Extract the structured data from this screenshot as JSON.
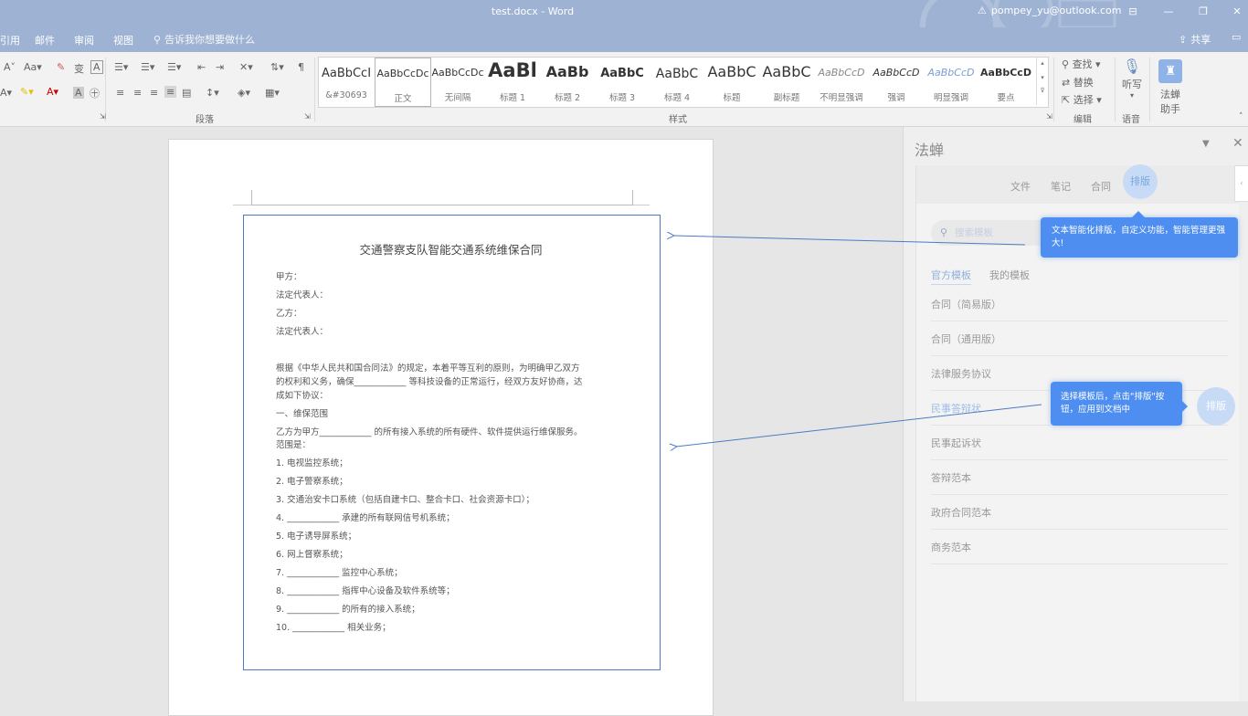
{
  "window": {
    "title": "test.docx  -  Word",
    "account": "pompey_yu@outlook.com"
  },
  "menu_tabs": [
    "引用",
    "邮件",
    "审阅",
    "视图"
  ],
  "tell_me": "告诉我你想要做什么",
  "share_label": "共享",
  "ribbon": {
    "font_group": {
      "case_label": "Aa",
      "grow_font": "A",
      "font_color_label": "A"
    },
    "paragraph_label": "段落",
    "styles_label": "样式",
    "styles": [
      {
        "sample": "AaBbCcI",
        "name": "&#30693"
      },
      {
        "sample": "AaBbCcDc",
        "name": "正文"
      },
      {
        "sample": "AaBbCcDc",
        "name": "无间隔"
      },
      {
        "sample": "AaBl",
        "name": "标题 1"
      },
      {
        "sample": "AaBb",
        "name": "标题 2"
      },
      {
        "sample": "AaBbC",
        "name": "标题 3"
      },
      {
        "sample": "AaBbC",
        "name": "标题 4"
      },
      {
        "sample": "AaBbC",
        "name": "标题"
      },
      {
        "sample": "AaBbC",
        "name": "副标题"
      },
      {
        "sample": "AaBbCcD",
        "name": "不明显强调"
      },
      {
        "sample": "AaBbCcD",
        "name": "强调"
      },
      {
        "sample": "AaBbCcD",
        "name": "明显强调"
      },
      {
        "sample": "AaBbCcD",
        "name": "要点"
      }
    ],
    "editing": {
      "find": "查找",
      "replace": "替换",
      "select": "选择",
      "label": "编辑"
    },
    "voice": {
      "dictate": "听写",
      "label": "语音"
    },
    "fachan": {
      "line1": "法蝉",
      "line2": "助手"
    }
  },
  "document": {
    "title": "交通警察支队智能交通系统维保合同",
    "lines": [
      "甲方：",
      "法定代表人：",
      "乙方：",
      "法定代表人：",
      "根据《中华人民共和国合同法》的规定，本着平等互利的原则，为明确甲乙双方",
      "的权利和义务，确保____________ 等科技设备的正常运行，经双方友好协商，达",
      "成如下协议：",
      "一、维保范围",
      "乙方为甲方____________ 的所有接入系统的所有硬件、软件提供运行维保服务。",
      "范围是：",
      "1. 电视监控系统；",
      "2. 电子警察系统；",
      "3. 交通治安卡口系统（包括自建卡口、整合卡口、社会资源卡口）；",
      "4. ____________ 承建的所有联网信号机系统；",
      "5. 电子诱导屏系统；",
      "6. 网上督察系统；",
      "7. ____________ 监控中心系统；",
      "8. ____________ 指挥中心设备及软件系统等；",
      "9. ____________ 的所有的接入系统；",
      "10. ____________ 相关业务；"
    ]
  },
  "pane": {
    "title": "法蝉",
    "nav": [
      "文件",
      "笔记",
      "合同",
      "排版"
    ],
    "search_placeholder": "搜索模板",
    "subtabs": [
      "官方模板",
      "我的模板"
    ],
    "templates": [
      "合同（简易版）",
      "合同（通用版）",
      "法律服务协议",
      "民事答辩状",
      "民事起诉状",
      "答辩范本",
      "政府合同范本",
      "商务范本"
    ]
  },
  "callouts": {
    "top": "文本智能化排版，自定义功能，智能管理更强大!",
    "bottom": "选择模板后，点击\"排版\"按钮，应用到文档中",
    "bottom_button": "排版"
  },
  "colors": {
    "titlebar": "#9eb3d3",
    "accent": "#4d8ef0",
    "selection_border": "#4a7cc4",
    "circle": "#c7dbf7"
  }
}
